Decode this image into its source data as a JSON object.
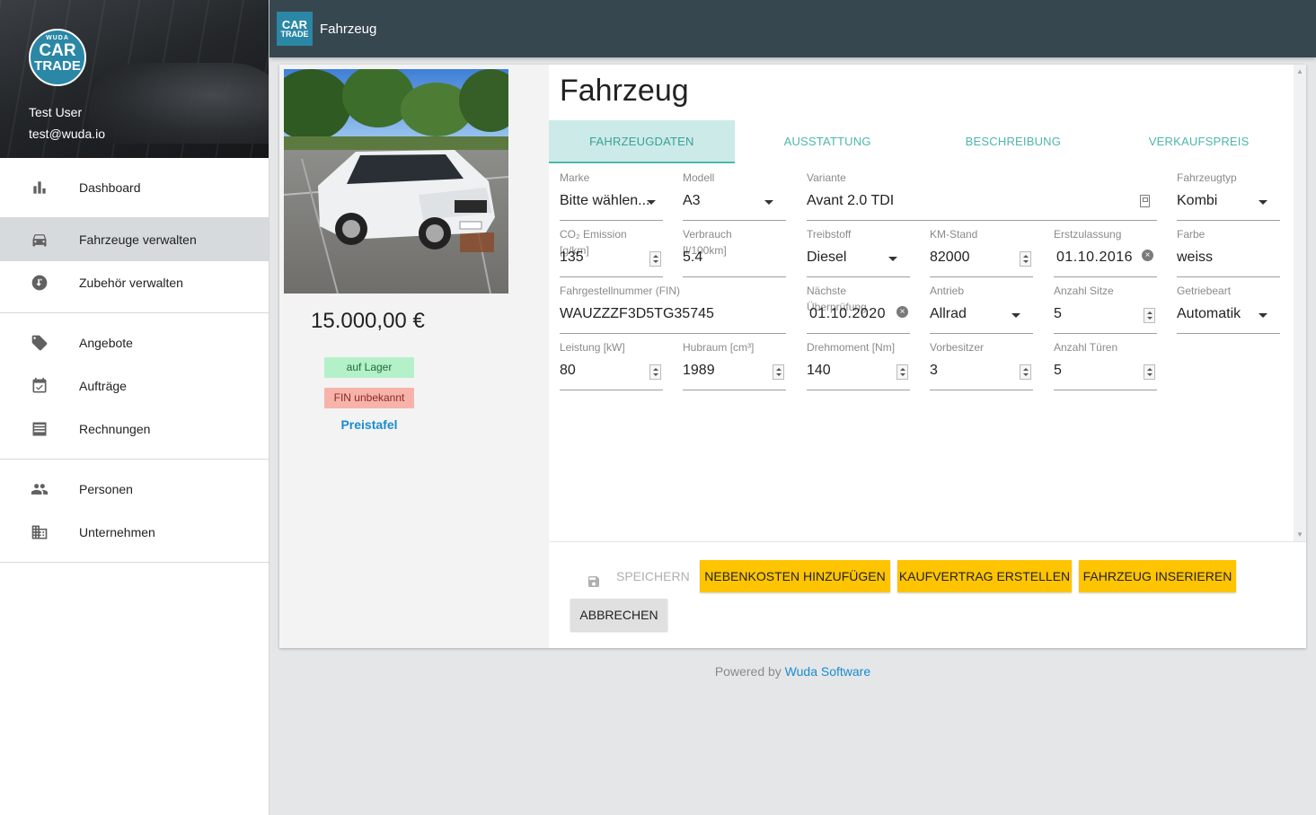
{
  "brand": {
    "logo_top": "WUDA",
    "logo_mid": "CAR",
    "logo_bottom": "TRADE",
    "accent_color": "#2b87a6"
  },
  "user": {
    "name": "Test User",
    "email": "test@wuda.io"
  },
  "sidebar": {
    "groups": [
      [
        {
          "label": "Dashboard",
          "icon": "bar-chart-icon",
          "active": false
        }
      ],
      [
        {
          "label": "Fahrzeuge verwalten",
          "icon": "car-icon",
          "active": true
        },
        {
          "label": "Zubehör verwalten",
          "icon": "swap-icon",
          "active": false
        }
      ],
      [
        {
          "label": "Angebote",
          "icon": "tag-icon",
          "active": false
        },
        {
          "label": "Aufträge",
          "icon": "calendar-check-icon",
          "active": false
        },
        {
          "label": "Rechnungen",
          "icon": "receipt-icon",
          "active": false
        }
      ],
      [
        {
          "label": "Personen",
          "icon": "people-icon",
          "active": false
        },
        {
          "label": "Unternehmen",
          "icon": "building-icon",
          "active": false
        }
      ]
    ]
  },
  "topbar": {
    "title": "Fahrzeug",
    "color": "#37474f"
  },
  "vehicle": {
    "price": "15.000,00 €",
    "stock_badge": "auf Lager",
    "fin_badge": "FIN unbekannt",
    "price_link": "Preistafel"
  },
  "main": {
    "title": "Fahrzeug",
    "tabs": [
      {
        "label": "FAHRZEUGDATEN",
        "active": true
      },
      {
        "label": "AUSSTATTUNG",
        "active": false
      },
      {
        "label": "BESCHREIBUNG",
        "active": false
      },
      {
        "label": "VERKAUFSPREIS",
        "active": false
      }
    ]
  },
  "fields": {
    "marke": {
      "label": "Marke",
      "value": "Bitte wählen..."
    },
    "modell": {
      "label": "Modell",
      "value": "A3"
    },
    "variante": {
      "label": "Variante",
      "value": "Avant 2.0 TDI"
    },
    "fahrzeugtyp": {
      "label": "Fahrzeugtyp",
      "value": "Kombi"
    },
    "co2": {
      "label": "CO₂ Emission\n[g/km]",
      "value": "135"
    },
    "verbrauch": {
      "label": "Verbrauch\n[l/100km]",
      "value": "5.4"
    },
    "treibstoff": {
      "label": "Treibstoff",
      "value": "Diesel"
    },
    "km_stand": {
      "label": "KM-Stand",
      "value": "82000"
    },
    "erstzulassung": {
      "label": "Erstzulassung",
      "value": "01.10.2016"
    },
    "farbe": {
      "label": "Farbe",
      "value": "weiss"
    },
    "fin": {
      "label": "Fahrgestellnummer (FIN)",
      "value": "WAUZZZF3D5TG35745"
    },
    "naechste_ueberpruefung": {
      "label": "Nächste\nÜberprüfung",
      "value": "01.10.2020"
    },
    "antrieb": {
      "label": "Antrieb",
      "value": "Allrad"
    },
    "anzahl_sitze": {
      "label": "Anzahl Sitze",
      "value": "5"
    },
    "getriebeart": {
      "label": "Getriebeart",
      "value": "Automatik"
    },
    "leistung": {
      "label": "Leistung [kW]",
      "value": "80"
    },
    "hubraum": {
      "label": "Hubraum [cm³]",
      "value": "1989"
    },
    "drehmoment": {
      "label": "Drehmoment [Nm]",
      "value": "140"
    },
    "vorbesitzer": {
      "label": "Vorbesitzer",
      "value": "3"
    },
    "anzahl_tueren": {
      "label": "Anzahl Türen",
      "value": "5"
    }
  },
  "actions": {
    "save": "SPEICHERN",
    "nebenkosten": "NEBENKOSTEN HINZUFÜGEN",
    "kaufvertrag": "KAUFVERTRAG ERSTELLEN",
    "inserieren": "FAHRZEUG INSERIEREN",
    "cancel": "ABBRECHEN",
    "button_color": "#ffc400"
  },
  "footer": {
    "prefix": "Powered by ",
    "link": "Wuda Software"
  }
}
